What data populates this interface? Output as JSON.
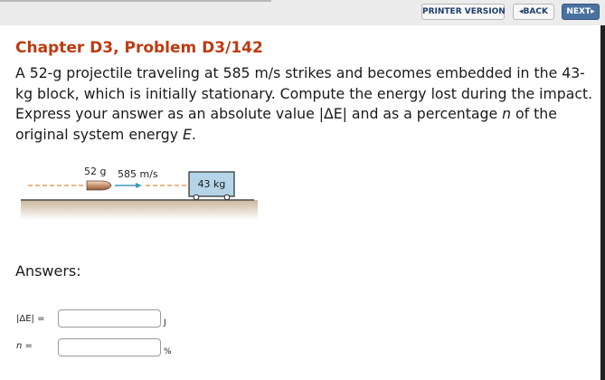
{
  "toolbar": {
    "printer_label": "PRINTER VERSION",
    "back_arrow": "◂",
    "back_label": "BACK",
    "next_label": "NEXT",
    "next_arrow": "▸"
  },
  "problem": {
    "chapter_title": "Chapter D3, Problem D3/142",
    "text_main": "A 52-g projectile traveling at 585 m/s strikes and becomes embedded in the 43-kg block, which is initially stationary. Compute the energy lost during the impact. Express your answer as an absolute value |ΔE| and as a percentage ",
    "n_var": "n",
    "text_mid": " of the original system energy ",
    "e_var": "E",
    "text_end": "."
  },
  "figure": {
    "projectile_mass": "52 g",
    "velocity": "585 m/s",
    "block_mass": "43 kg"
  },
  "answers": {
    "label": "Answers:",
    "delta_e_label": "|ΔE| =",
    "delta_e_value": "",
    "delta_e_unit": "J",
    "n_label_var": "n",
    "n_label_eq": " =",
    "n_value": "",
    "n_unit": "%"
  },
  "colors": {
    "chapter_title": "#bd3b12",
    "next_button": "#4a72a0",
    "block_fill": "#b5d4e8",
    "velocity_arrow": "#3a9bbf"
  }
}
